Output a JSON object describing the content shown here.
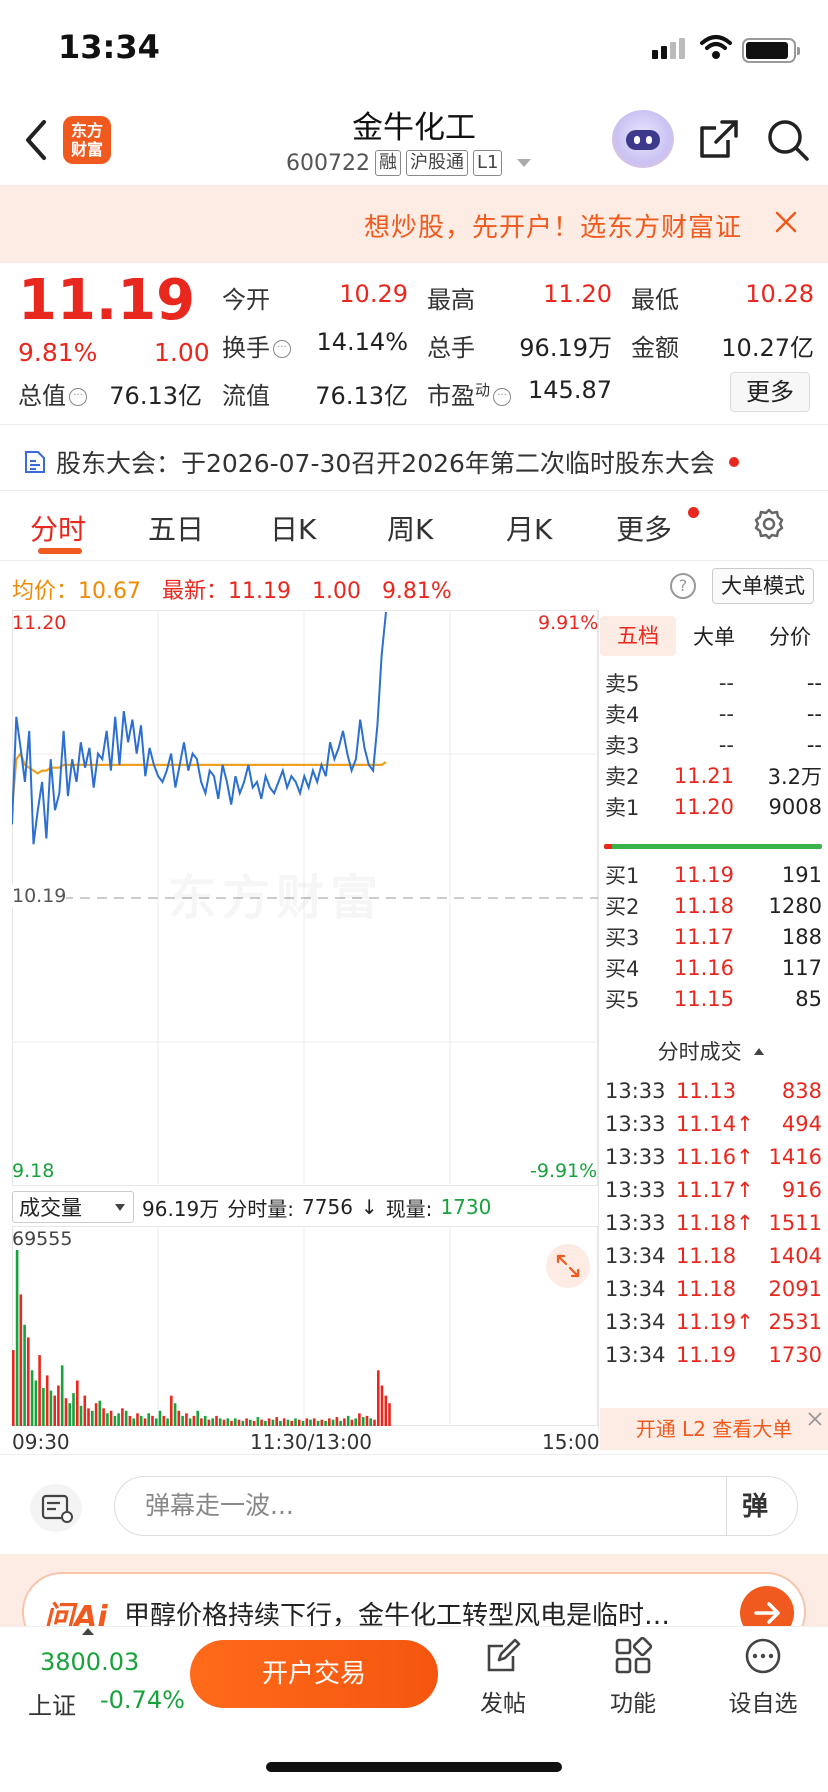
{
  "status_bar": {
    "time": "13:34"
  },
  "header": {
    "logo_text_1": "东方",
    "logo_text_2": "财富",
    "stock_name": "金牛化工",
    "stock_code": "600722",
    "tags": [
      "融",
      "沪股通",
      "L1"
    ]
  },
  "banner": {
    "text": "想炒股，先开户！选东方财富证"
  },
  "quote": {
    "price": "11.19",
    "change_pct": "9.81%",
    "change": "1.00",
    "rows": [
      [
        {
          "label": "今开",
          "value": "10.29",
          "color": "red"
        },
        {
          "label": "最高",
          "value": "11.20",
          "color": "red"
        },
        {
          "label": "最低",
          "value": "10.28",
          "color": "red"
        }
      ],
      [
        {
          "label": "换手",
          "value": "14.14%",
          "color": "dark"
        },
        {
          "label": "总手",
          "value": "96.19万",
          "color": "dark"
        },
        {
          "label": "金额",
          "value": "10.27亿",
          "color": "dark"
        }
      ],
      [
        {
          "label": "总值",
          "value": "76.13亿",
          "color": "dark"
        },
        {
          "label": "流值",
          "value": "76.13亿",
          "color": "dark"
        },
        {
          "label": "市盈",
          "value": "145.87",
          "color": "dark"
        }
      ]
    ],
    "pe_sup": "动",
    "more_label": "更多"
  },
  "notice": {
    "text": "股东大会：于2026-07-30召开2026年第二次临时股东大会"
  },
  "tabs": [
    "分时",
    "五日",
    "日K",
    "周K",
    "月K",
    "更多"
  ],
  "stat_line": {
    "avg_label": "均价：",
    "avg_value": "10.67",
    "latest_label": "最新：",
    "latest_value": "11.19",
    "latest_change": "1.00",
    "latest_pct": "9.81%",
    "help_label": "?",
    "big_mode_label": "大单模式"
  },
  "chart_data": {
    "type": "line",
    "x_ticks": [
      "09:30",
      "11:30/13:00",
      "15:00"
    ],
    "y_top": "11.20",
    "y_bottom": "9.18",
    "y_mid": "10.19",
    "pct_top": "9.91%",
    "pct_bottom": "-9.91%",
    "ylim": [
      9.18,
      11.2
    ],
    "prev_close": 10.19,
    "series": [
      {
        "values": [
          10.45,
          10.83,
          10.72,
          10.6,
          10.78,
          10.38,
          10.5,
          10.6,
          10.4,
          10.68,
          10.5,
          10.56,
          10.78,
          10.55,
          10.68,
          10.6,
          10.74,
          10.65,
          10.72,
          10.58,
          10.7,
          10.68,
          10.78,
          10.64,
          10.83,
          10.66,
          10.85,
          10.74,
          10.82,
          10.7,
          10.8,
          10.62,
          10.72,
          10.66,
          10.62,
          10.6,
          10.64,
          10.7,
          10.58,
          10.66,
          10.74,
          10.64,
          10.7,
          10.68,
          10.6,
          10.56,
          10.64,
          10.62,
          10.54,
          10.66,
          10.6,
          10.52,
          10.62,
          10.56,
          10.6,
          10.66,
          10.58,
          10.6,
          10.54,
          10.62,
          10.58,
          10.56,
          10.6,
          10.64,
          10.58,
          10.62,
          10.6,
          10.56,
          10.62,
          10.58,
          10.64,
          10.6,
          10.66,
          10.62,
          10.74,
          10.68,
          10.72,
          10.78,
          10.7,
          10.64,
          10.68,
          10.82,
          10.72,
          10.66,
          10.64,
          10.8,
          11.05,
          11.2
        ]
      },
      {
        "values": [
          10.5,
          10.68,
          10.7,
          10.66,
          10.65,
          10.64,
          10.63,
          10.64,
          10.64,
          10.65,
          10.65,
          10.65,
          10.66,
          10.66,
          10.66,
          10.66,
          10.66,
          10.66,
          10.66,
          10.66,
          10.66,
          10.66,
          10.66,
          10.66,
          10.66,
          10.66,
          10.66,
          10.66,
          10.66,
          10.66,
          10.66,
          10.66,
          10.66,
          10.66,
          10.66,
          10.66,
          10.66,
          10.66,
          10.66,
          10.66,
          10.66,
          10.66,
          10.66,
          10.66,
          10.66,
          10.66,
          10.66,
          10.66,
          10.66,
          10.66,
          10.66,
          10.66,
          10.66,
          10.66,
          10.66,
          10.66,
          10.66,
          10.66,
          10.66,
          10.66,
          10.66,
          10.66,
          10.66,
          10.66,
          10.66,
          10.66,
          10.66,
          10.66,
          10.66,
          10.66,
          10.66,
          10.66,
          10.66,
          10.66,
          10.66,
          10.66,
          10.66,
          10.66,
          10.66,
          10.66,
          10.66,
          10.66,
          10.66,
          10.66,
          10.66,
          10.66,
          10.66,
          10.67
        ]
      }
    ],
    "volume": {
      "max_label": "69555",
      "values": [
        30000,
        69555,
        52000,
        40000,
        35000,
        22000,
        18000,
        28000,
        15000,
        20000,
        14000,
        12000,
        16000,
        24000,
        11000,
        9000,
        13000,
        18000,
        8000,
        12000,
        7000,
        6000,
        9000,
        10000,
        7000,
        5000,
        6000,
        4000,
        5000,
        7000,
        6000,
        4000,
        3000,
        5000,
        4000,
        3000,
        5000,
        4000,
        3000,
        6000,
        4000,
        3000,
        12000,
        9000,
        6000,
        4000,
        5000,
        3000,
        4000,
        6000,
        3000,
        4000,
        2500,
        3000,
        4000,
        3000,
        2500,
        3000,
        2000,
        3000,
        2500,
        2000,
        3000,
        2500,
        2000,
        3500,
        2500,
        2000,
        3000,
        2500,
        3500,
        2000,
        3000,
        2500,
        2000,
        3000,
        2500,
        2000,
        3000,
        2500,
        3000,
        2000,
        2500,
        2000,
        3000,
        2500,
        3500,
        2000,
        3000,
        4000,
        2500,
        3000,
        5000,
        3500,
        4000,
        3000,
        2500,
        22000,
        16000,
        12000,
        9000
      ],
      "colors": [
        "r",
        "g",
        "r",
        "g",
        "r",
        "g",
        "g",
        "r",
        "g",
        "r",
        "g",
        "r",
        "r",
        "g",
        "r",
        "g",
        "g",
        "r",
        "g",
        "r",
        "r",
        "g",
        "r",
        "g",
        "r",
        "g",
        "r",
        "g",
        "g",
        "r",
        "g",
        "r",
        "g",
        "r",
        "g",
        "r",
        "g",
        "r",
        "g",
        "g",
        "r",
        "g",
        "r",
        "g",
        "r",
        "g",
        "r",
        "g",
        "r",
        "g",
        "r",
        "g",
        "r",
        "g",
        "r",
        "g",
        "r",
        "g",
        "r",
        "g",
        "r",
        "g",
        "r",
        "g",
        "r",
        "g",
        "r",
        "g",
        "r",
        "g",
        "r",
        "g",
        "r",
        "g",
        "r",
        "g",
        "r",
        "g",
        "r",
        "g",
        "r",
        "g",
        "r",
        "g",
        "r",
        "g",
        "r",
        "g",
        "r",
        "g",
        "r",
        "g",
        "r",
        "g",
        "r",
        "g",
        "r",
        "r",
        "r",
        "r",
        "r"
      ]
    }
  },
  "volume_bar": {
    "selector_label": "成交量",
    "total": "96.19万",
    "minute_label": "分时量:",
    "minute_value": "7756",
    "arrow": "↓",
    "now_label": "现量:",
    "now_value": "1730"
  },
  "order_book": {
    "tabs": [
      "五档",
      "大单",
      "分价"
    ],
    "asks": [
      {
        "label": "卖5",
        "price": "--",
        "vol": "--"
      },
      {
        "label": "卖4",
        "price": "--",
        "vol": "--"
      },
      {
        "label": "卖3",
        "price": "--",
        "vol": "--"
      },
      {
        "label": "卖2",
        "price": "11.21",
        "vol": "3.2万"
      },
      {
        "label": "卖1",
        "price": "11.20",
        "vol": "9008"
      }
    ],
    "bids": [
      {
        "label": "买1",
        "price": "11.19",
        "vol": "191"
      },
      {
        "label": "买2",
        "price": "11.18",
        "vol": "1280"
      },
      {
        "label": "买3",
        "price": "11.17",
        "vol": "188"
      },
      {
        "label": "买4",
        "price": "11.16",
        "vol": "117"
      },
      {
        "label": "买5",
        "price": "11.15",
        "vol": "85"
      }
    ],
    "trades_title": "分时成交",
    "trades": [
      {
        "time": "13:33",
        "price": "11.13",
        "vol": "838"
      },
      {
        "time": "13:33",
        "price": "11.14↑",
        "vol": "494"
      },
      {
        "time": "13:33",
        "price": "11.16↑",
        "vol": "1416"
      },
      {
        "time": "13:33",
        "price": "11.17↑",
        "vol": "916"
      },
      {
        "time": "13:33",
        "price": "11.18↑",
        "vol": "1511"
      },
      {
        "time": "13:34",
        "price": "11.18",
        "vol": "1404"
      },
      {
        "time": "13:34",
        "price": "11.18",
        "vol": "2091"
      },
      {
        "time": "13:34",
        "price": "11.19↑",
        "vol": "2531"
      },
      {
        "time": "13:34",
        "price": "11.19",
        "vol": "1730"
      }
    ],
    "l2_label": "开通 L2 查看大单"
  },
  "comment": {
    "placeholder": "弹幕走一波...",
    "dan_label": "弹"
  },
  "ai": {
    "logo": "问Ai",
    "text": "甲醇价格持续下行，金牛化工转型风电是临时…"
  },
  "bottom": {
    "index_value": "3800.03",
    "index_name": "上证",
    "index_pct": "-0.74%",
    "trade_label": "开户交易",
    "nav": [
      "发帖",
      "功能",
      "设自选"
    ]
  },
  "watermark": "东方财富"
}
